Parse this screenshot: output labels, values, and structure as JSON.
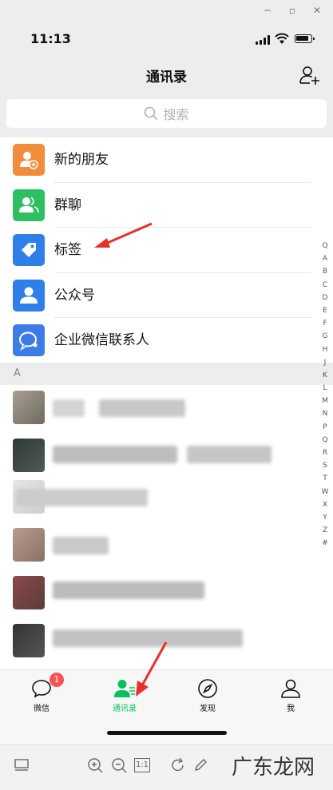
{
  "status": {
    "time": "11:13"
  },
  "header": {
    "title": "通讯录"
  },
  "search": {
    "placeholder": "搜索"
  },
  "menu": {
    "items": [
      {
        "label": "新的朋友",
        "color": "#f08c3b",
        "icon": "new-friend-icon"
      },
      {
        "label": "群聊",
        "color": "#2fbf63",
        "icon": "group-chat-icon"
      },
      {
        "label": "标签",
        "color": "#2f7fe8",
        "icon": "tag-icon"
      },
      {
        "label": "公众号",
        "color": "#2f7fe8",
        "icon": "official-account-icon"
      },
      {
        "label": "企业微信联系人",
        "color": "#3d7ce6",
        "icon": "work-contacts-icon"
      }
    ]
  },
  "contacts": {
    "section_letter": "A"
  },
  "index": [
    "Q",
    "A",
    "B",
    "C",
    "D",
    "E",
    "F",
    "G",
    "H",
    "J",
    "K",
    "L",
    "M",
    "N",
    "P",
    "Q",
    "R",
    "S",
    "T",
    "W",
    "X",
    "Y",
    "Z",
    "#"
  ],
  "tabs": [
    {
      "label": "微信",
      "badge": "1",
      "icon": "chat-icon"
    },
    {
      "label": "通讯录",
      "icon": "contacts-icon",
      "active": true
    },
    {
      "label": "发现",
      "icon": "discover-icon"
    },
    {
      "label": "我",
      "icon": "me-icon"
    }
  ],
  "toolbar": {
    "ratio_label": "1:1"
  },
  "watermark": {
    "text": "广东龙网"
  },
  "colors": {
    "accent": "#07c160",
    "badge": "#fa5151",
    "arrow": "#e8302a"
  }
}
